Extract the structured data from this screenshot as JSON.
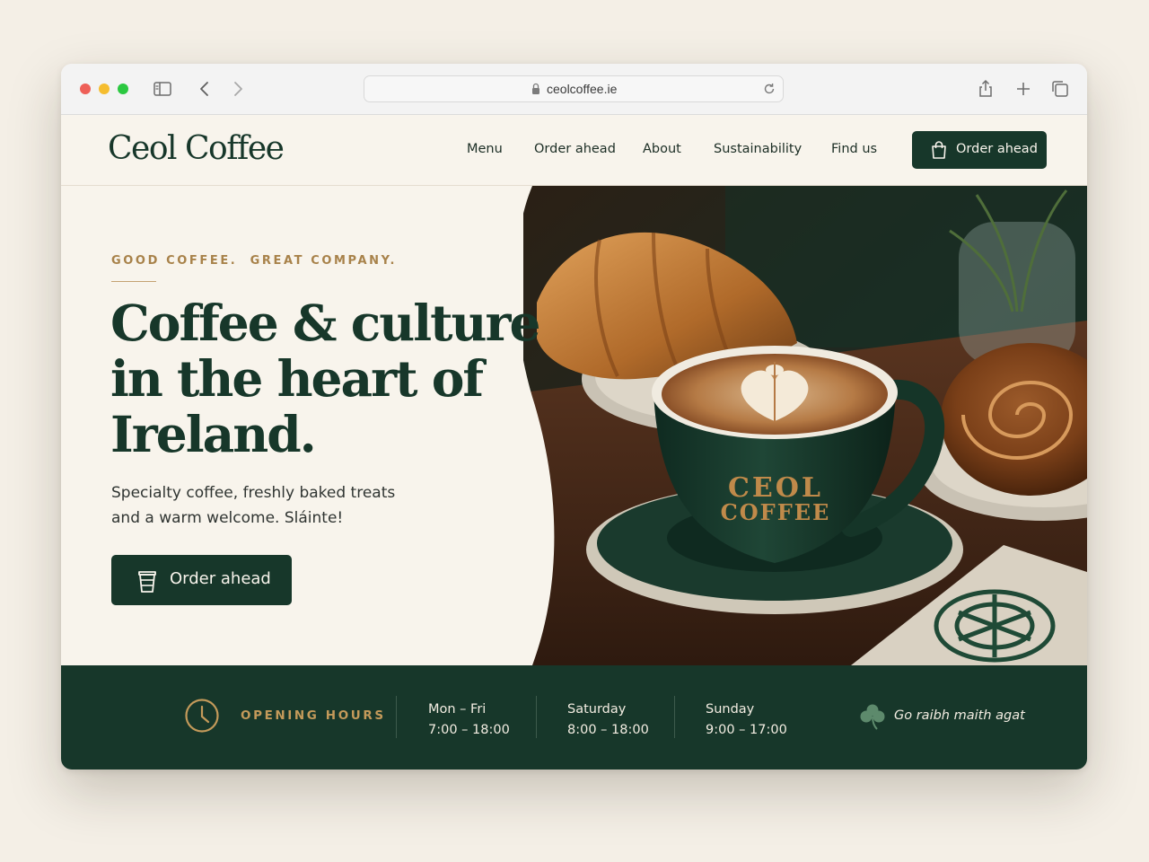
{
  "browser": {
    "url": "ceolcoffee.ie",
    "icons": [
      "sidebar-icon",
      "back-icon",
      "forward-icon",
      "lock-icon",
      "reload-icon",
      "share-icon",
      "new-tab-icon",
      "tabs-overview-icon"
    ]
  },
  "header": {
    "logo": "Ceol Coffee",
    "nav": [
      "Menu",
      "Order ahead",
      "About",
      "Sustainability",
      "Find us"
    ],
    "cta_label": "Order ahead",
    "cta_icon": "shopping-bag-icon"
  },
  "hero": {
    "eyebrow": "GOOD COFFEE.  GREAT COMPANY.",
    "headline_lines": [
      "Coffee & culture",
      "in the heart of",
      "Ireland."
    ],
    "subtext_lines": [
      "Specialty coffee, freshly baked treats",
      "and a warm welcome. Sláinte!"
    ],
    "cta_label": "Order ahead",
    "cta_icon": "coffee-cup-icon",
    "cup_lettering": [
      "CEOL",
      "COFFEE"
    ]
  },
  "hours": {
    "title": "OPENING HOURS",
    "icon": "clock-icon",
    "slots": [
      {
        "day": "Mon – Fri",
        "time": "7:00 – 18:00"
      },
      {
        "day": "Saturday",
        "time": "8:00 – 18:00"
      },
      {
        "day": "Sunday",
        "time": "9:00 – 17:00"
      }
    ],
    "thanks": "Go raibh maith agat",
    "thanks_icon": "shamrock-icon"
  },
  "colors": {
    "brand_green": "#17372a",
    "cream": "#f8f4ec",
    "gold": "#a8824a"
  }
}
